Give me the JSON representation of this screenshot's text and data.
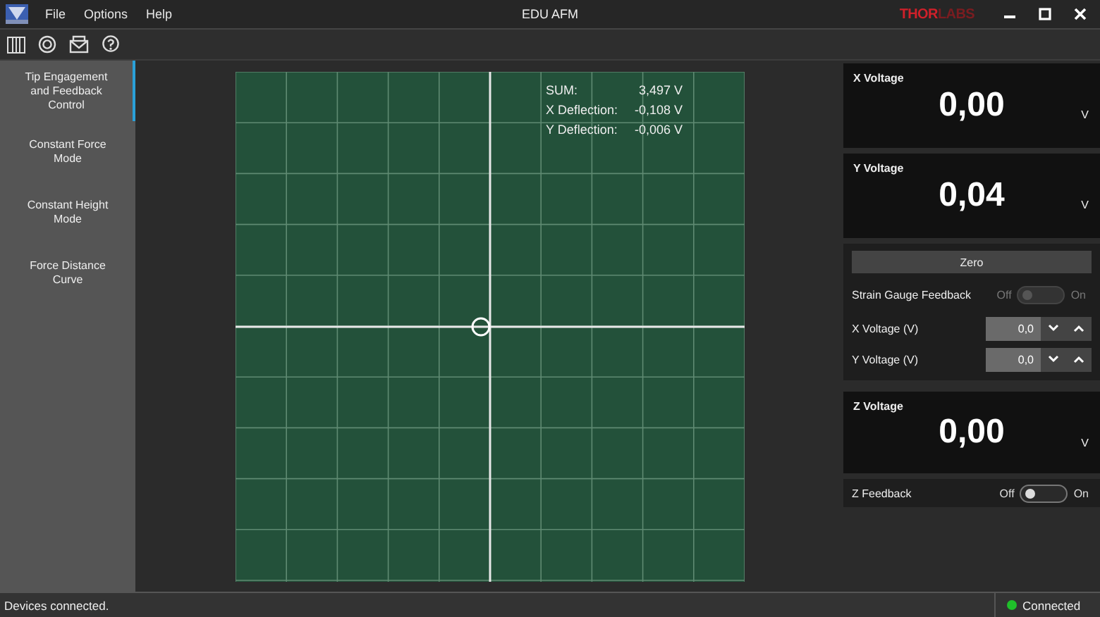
{
  "window": {
    "title": "EDU AFM",
    "logo": [
      "THOR",
      "LABS"
    ]
  },
  "menu": [
    "File",
    "Options",
    "Help"
  ],
  "sidebar": {
    "items": [
      {
        "label": "Tip Engagement and Feedback Control",
        "selected": true
      },
      {
        "label": "Constant Force Mode",
        "selected": false
      },
      {
        "label": "Constant Height Mode",
        "selected": false
      },
      {
        "label": "Force Distance Curve",
        "selected": false
      }
    ]
  },
  "readouts": [
    {
      "label": "SUM:",
      "value": "3,497 V"
    },
    {
      "label": "X Deflection:",
      "value": "-0,108 V"
    },
    {
      "label": "Y Deflection:",
      "value": "-0,006 V"
    }
  ],
  "voltages_top": [
    {
      "title": "X Voltage",
      "value": "0,00",
      "unit": "V"
    },
    {
      "title": "Y Voltage",
      "value": "0,04",
      "unit": "V"
    }
  ],
  "controls": {
    "zero_button": "Zero",
    "strain_gauge": {
      "label": "Strain Gauge Feedback",
      "off": "Off",
      "on_label": "On",
      "on": false,
      "disabled": true
    },
    "spinners": [
      {
        "label": "X Voltage (V)",
        "value": "0,0"
      },
      {
        "label": "Y Voltage (V)",
        "value": "0,0"
      }
    ]
  },
  "z_voltage": {
    "title": "Z Voltage",
    "value": "0,00",
    "unit": "V"
  },
  "z_feedback": {
    "label": "Z Feedback",
    "off": "Off",
    "on_label": "On",
    "on": false,
    "disabled": false
  },
  "status_bar": {
    "message": "Devices connected.",
    "connection": "Connected",
    "connected": true
  }
}
